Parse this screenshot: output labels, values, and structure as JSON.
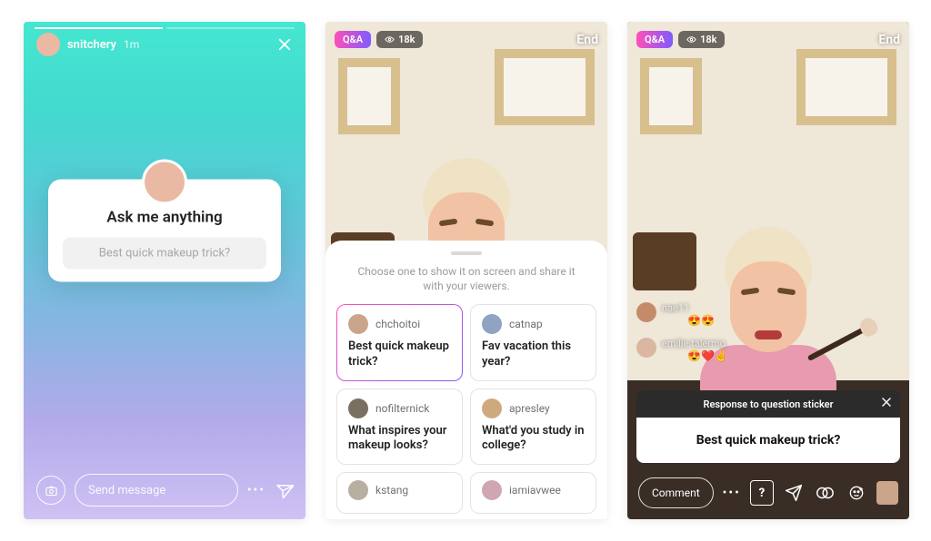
{
  "panel1": {
    "username": "snitchery",
    "time": "1m",
    "card_title": "Ask me anything",
    "card_placeholder": "Best quick makeup trick?",
    "message_placeholder": "Send message"
  },
  "live_header": {
    "qa_label": "Q&A",
    "viewers": "18k",
    "end": "End"
  },
  "panel2": {
    "sheet_hint": "Choose one to show it on screen and share it with your viewers.",
    "questions": [
      {
        "user": "chchoitoi",
        "text": "Best quick makeup trick?",
        "selected": true
      },
      {
        "user": "catnap",
        "text": "Fav vacation this year?",
        "selected": false
      },
      {
        "user": "nofilternick",
        "text": "What inspires your makeup looks?",
        "selected": false
      },
      {
        "user": "apresley",
        "text": "What'd you study in college?",
        "selected": false
      },
      {
        "user": "kstang",
        "text": "",
        "selected": false
      },
      {
        "user": "iamiavwee",
        "text": "",
        "selected": false
      }
    ]
  },
  "panel3": {
    "chat": [
      {
        "name": "nae11",
        "emoji": "😍😍"
      },
      {
        "name": "emilie.talermo",
        "emoji": "😍❤️✌️"
      }
    ],
    "response_bar": "Response to question sticker",
    "response_text": "Best quick makeup trick?",
    "comment_placeholder": "Comment",
    "question_glyph": "?"
  }
}
